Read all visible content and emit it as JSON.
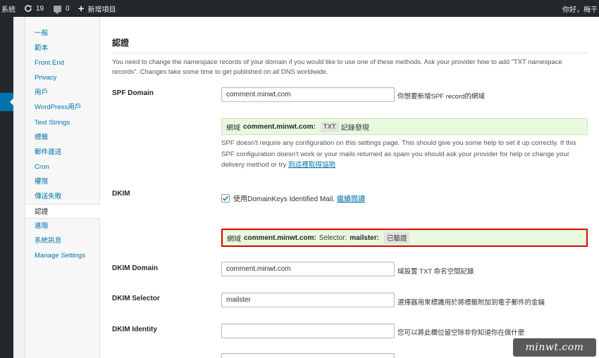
{
  "adminbar": {
    "site_label": "系統",
    "updates_count": "19",
    "comments_count": "0",
    "new_label": "新增項目",
    "greeting": "你好，梅干"
  },
  "settings_nav": {
    "items": [
      {
        "label": "一般"
      },
      {
        "label": "範本"
      },
      {
        "label": "Front End"
      },
      {
        "label": "Privacy"
      },
      {
        "label": "用戶"
      },
      {
        "label": "WordPress用戶"
      },
      {
        "label": "Text Strings"
      },
      {
        "label": "標籤"
      },
      {
        "label": "郵件遞送"
      },
      {
        "label": "Cron"
      },
      {
        "label": "權限"
      },
      {
        "label": "傳送失敗"
      },
      {
        "label": "認證",
        "active": true
      },
      {
        "label": "進階"
      },
      {
        "label": "系統訊息"
      },
      {
        "label": "Manage Settings"
      }
    ]
  },
  "main": {
    "section_title": "認證",
    "intro": "You need to change the namespace records of your domain if you would like to use one of these methods. Ask your provider how to add \"TXT namespace records\". Changes take some time to get published on all DNS worldwide.",
    "spf": {
      "label": "SPF Domain",
      "value": "comment.minwt.com",
      "desc": "你想要新增SPF record的網域",
      "notice_prefix": "網域",
      "notice_domain": "comment.minwt.com:",
      "notice_code": "TXT",
      "notice_suffix": "記錄發現",
      "para_text": "SPF doesn't require any configuration on this settings page. This should give you some help to set it up correctly. If this SPF configuration doesn't work or your mails returned as spam you should ask your provider for help or change your delivery method or try",
      "para_link": "到這裡取得協助"
    },
    "dkim": {
      "label": "DKIM",
      "checkbox_label": "使用DomainKeys Identified Mail.",
      "checkbox_link": "繼續閱讀",
      "checked": true,
      "notice_prefix": "網域",
      "notice_domain": "comment.minwt.com:",
      "notice_selector_label": "Selector:",
      "notice_selector": "mailster:",
      "notice_status": "已驗證"
    },
    "dkim_domain": {
      "label": "DKIM Domain",
      "value": "comment.minwt.com",
      "desc": "域設置 TXT 命名空間記錄"
    },
    "dkim_selector": {
      "label": "DKIM Selector",
      "value": "mailster",
      "desc": "選擇器用來標識用於將標籤附加到電子郵件的金鑰"
    },
    "dkim_identity": {
      "label": "DKIM Identity",
      "value": "",
      "desc": "您可以將此欄位留空除非你知道你在做什麼"
    }
  },
  "watermark": "minwt.com",
  "colors": {
    "adminbar_bg": "#23282d",
    "accent": "#0073aa",
    "notice_bg": "#e8f9e0",
    "highlight_border": "#e00000"
  }
}
